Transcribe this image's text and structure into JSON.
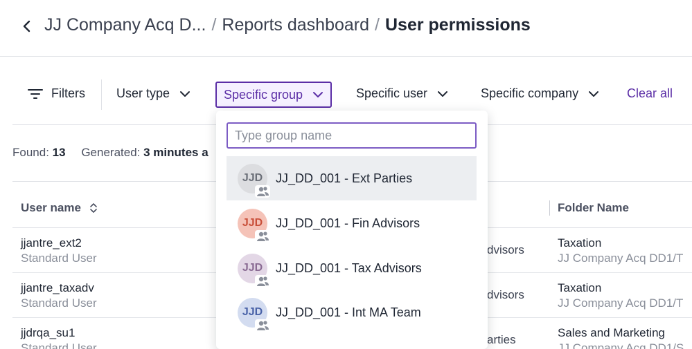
{
  "breadcrumb": {
    "items": [
      "JJ Company Acq D...",
      "Reports dashboard"
    ],
    "separator": "/",
    "current": "User permissions"
  },
  "filters": {
    "filters_label": "Filters",
    "user_type": "User type",
    "specific_group": "Specific group",
    "specific_user": "Specific user",
    "specific_company": "Specific company",
    "clear_all": "Clear all"
  },
  "summary": {
    "found_label": "Found:",
    "found_value": "13",
    "generated_label": "Generated:",
    "generated_value": "3 minutes a"
  },
  "table": {
    "columns": {
      "user_name": "User name",
      "folder_name": "Folder Name"
    },
    "rows": [
      {
        "user": "jjantre_ext2",
        "role": "Standard User",
        "group": "dvisors",
        "folder": "Taxation",
        "path": "JJ Company Acq DD1/T"
      },
      {
        "user": "jjantre_taxadv",
        "role": "Standard User",
        "group": "dvisors",
        "folder": "Taxation",
        "path": "JJ Company Acq DD1/T"
      },
      {
        "user": "jjdrqa_su1",
        "role": "Standard User",
        "group": "arties",
        "folder": "Sales and Marketing",
        "path": "JJ Company Acq DD1/S"
      }
    ]
  },
  "dropdown": {
    "search_placeholder": "Type group name",
    "options": [
      {
        "initials": "JJD",
        "label": "JJ_DD_001 - Ext Parties",
        "bg": "#dcdde0",
        "fg": "#6b6f78"
      },
      {
        "initials": "JJD",
        "label": "JJ_DD_001 - Fin Advisors",
        "bg": "#f5c3b8",
        "fg": "#c9503a"
      },
      {
        "initials": "JJD",
        "label": "JJ_DD_001 - Tax Advisors",
        "bg": "#e3d7e6",
        "fg": "#8a6b93"
      },
      {
        "initials": "JJD",
        "label": "JJ_DD_001 - Int MA Team",
        "bg": "#d3dcf0",
        "fg": "#4a63a8"
      }
    ]
  },
  "colors": {
    "accent": "#5b2ea6",
    "text": "#1f2633",
    "muted": "#8a8f9a"
  },
  "icons": [
    "chevron-left-icon",
    "filter-lines-icon",
    "chevron-down-icon",
    "sort-icon",
    "group-icon"
  ]
}
